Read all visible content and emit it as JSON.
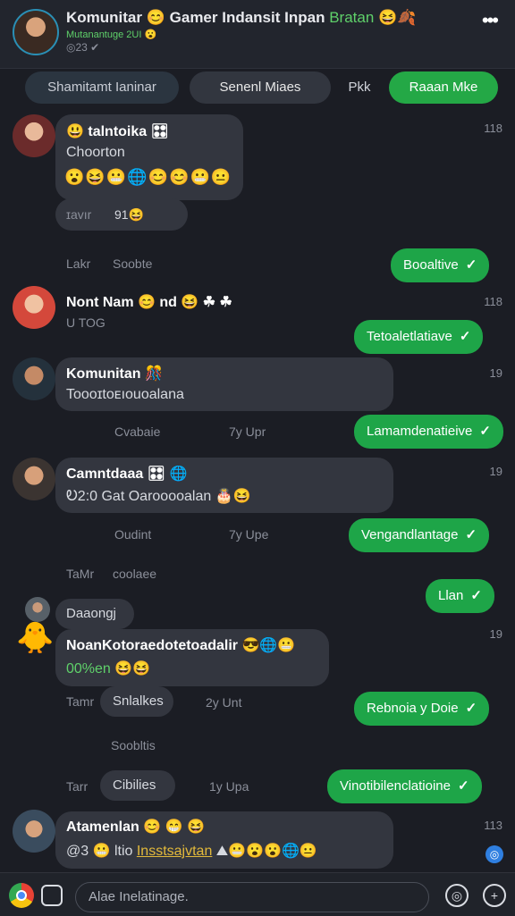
{
  "header": {
    "title": "Komunitar",
    "title_emoji": "😊",
    "title_rest": "Gamer Indansit Inpan",
    "title_accent": "Bratan",
    "title_emoji2": "😆🍂",
    "subtitle": "Mutanantuge 2UI 😮",
    "status": "◎23 ✔",
    "menu": "•••"
  },
  "chips": [
    "Shamitamt Ianinar",
    "Senenl Miaes",
    "Pkk",
    "Raaan Mke"
  ],
  "messages": {
    "m1": {
      "name": "talntoika 🎛",
      "name_icon": "😃",
      "text": "Choorton",
      "emoji": "😮😆😬🌐😊😊😬😐",
      "sub": "ɪavır",
      "sub2": "91😆",
      "time": "118"
    },
    "s1": {
      "left": "Lakr",
      "right": "Soobte"
    },
    "o1": {
      "text": "Booaltive"
    },
    "m2": {
      "name": "Nont Nam 😊 nd 😆 ☘ ☘",
      "text": "U TOG",
      "time": "118"
    },
    "o2": {
      "text": "Tetoaletlatiave"
    },
    "m3": {
      "name": "Komunitan 🎊",
      "text": "Toooɪtoᴇıouoalana",
      "time": "19"
    },
    "s3": {
      "left": "Cvabaie",
      "right": "7y Upr"
    },
    "o3": {
      "text": "Lamamdenatieive"
    },
    "m4": {
      "name": "Camntdaaa 🎛 🌐",
      "text": "Ꭷ2:0 Gat Oarooooalan 🎂😆",
      "time": "19"
    },
    "s4": {
      "left": "Oudint",
      "right": "7y Upe"
    },
    "o4": {
      "text": "Vengandlantage"
    },
    "s5": {
      "left": "TaMr",
      "right": "coolaee"
    },
    "o5": {
      "text": "Llan"
    },
    "m5": {
      "name": "NoanKotoraedotetoadalir 😎🌐😬",
      "small": "Daaongj",
      "text": "00%en 😆😆",
      "time": "19"
    },
    "s6": {
      "left": "Tamr",
      "mid": "Snlalkes",
      "right": "2y Unt"
    },
    "o6": {
      "text": "Rebnoia y Doie"
    },
    "s7": {
      "text": "Soobltis"
    },
    "s8": {
      "left": "Tarr",
      "mid": "Cibilies",
      "right": "1y Upa"
    },
    "o7": {
      "text": "Vinotibilenclatioine"
    },
    "m6": {
      "name": "Atamenlan 😊 😁 😆",
      "text": "@3 😬 ltio",
      "accent": "Insstsajvtan",
      "emoji": "⛰😬😮😮🌐😐",
      "time": "113"
    }
  },
  "composer": {
    "placeholder": "Alae Inelatinage."
  },
  "colors": {
    "background": "#1b1d24",
    "outgoing": "#1ea548",
    "incoming": "#33363f",
    "accent": "#5fd16a"
  }
}
